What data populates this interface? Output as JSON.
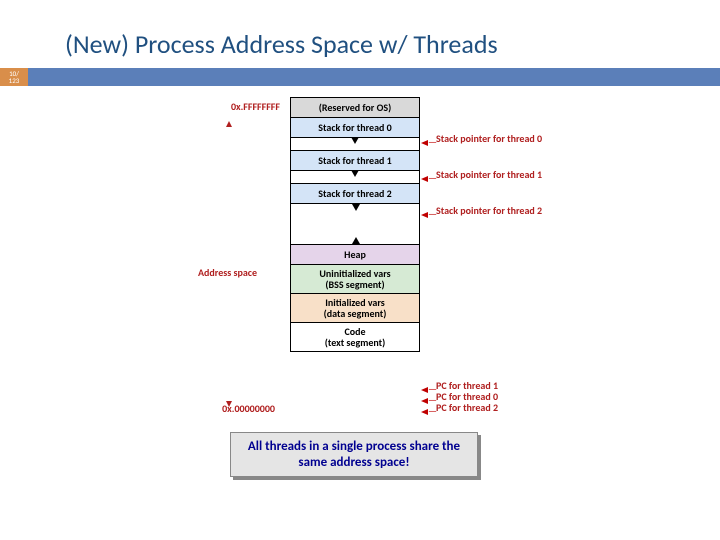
{
  "title": "(New) Process Address Space w/ Threads",
  "page": {
    "num": "10/",
    "total": "123"
  },
  "left": {
    "top_addr": "0x.FFFFFFFF",
    "addr_space": "Address space",
    "bot_addr": "0x.00000000"
  },
  "cells": {
    "os": "(Reserved for OS)",
    "s0": "Stack for thread 0",
    "s1": "Stack for thread 1",
    "s2": "Stack for thread 2",
    "heap": "Heap",
    "bss1": "Uninitialized vars",
    "bss2": "(BSS segment)",
    "data1": "Initialized vars",
    "data2": "(data segment)",
    "code1": "Code",
    "code2": "(text segment)"
  },
  "right": {
    "sp0": "Stack pointer for thread 0",
    "sp1": "Stack pointer for thread 1",
    "sp2": "Stack pointer for thread 2",
    "pc1": "PC for thread 1",
    "pc0": "PC for thread 0",
    "pc2": "PC for thread 2"
  },
  "caption": "All threads in a single process share the same address space!"
}
